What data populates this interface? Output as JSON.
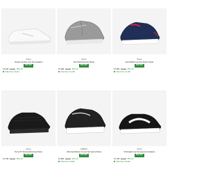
{
  "products": [
    {
      "brand": "Puma",
      "title": "Cintara Comfort Low-Top Sneakers",
      "discount": "55% OFF",
      "price": "₹1,349",
      "mrp": "₹2,999",
      "off": "55% off",
      "offer": "Offer Price: ₹1,214",
      "image": "white-low-sneaker"
    },
    {
      "brand": "Puma",
      "title": "Flex Mesh Running Shoes",
      "discount": "50% OFF",
      "price": "₹1,999",
      "mrp": "₹3,999",
      "off": "50% off",
      "offer": "Offer Price: ₹1,799",
      "image": "grey-running-shoe"
    },
    {
      "brand": "Puma",
      "title": "Axel Athletic Low-Top Sports Shoes",
      "discount": "50% OFF",
      "price": "₹1,999",
      "mrp": "₹3,999",
      "off": "50% off",
      "offer": "Offer Price: ₹1,799",
      "image": "navy-red-sports-shoe"
    },
    {
      "brand": "Puma",
      "title": "Puma ST Textured Running Shoes",
      "discount": "55% OFF",
      "price": "₹1,799",
      "mrp": "₹3,999",
      "off": "55% off",
      "offer": "",
      "image": "black-knit-shoe"
    },
    {
      "brand": "ADIDAS",
      "title": "Ultra-Sportiboost V1 Low-Top Sports Shoes",
      "discount": "40% OFF",
      "price": "₹4,800",
      "mrp": "₹7,999",
      "off": "40% off",
      "offer": "Offer Price: ₹4,320",
      "image": "black-chunky-shoe"
    },
    {
      "brand": "Puma",
      "title": "Perforated Low-Top Lace-Up Sneakers",
      "discount": "55% OFF",
      "price": "₹1,799",
      "mrp": "₹3,999",
      "off": "55% off",
      "offer": "Offer Price: ₹1,619",
      "image": "black-white-sneaker"
    }
  ],
  "colors": {
    "badge": "#2f8a3b",
    "image_bg": "#f4f4f4"
  }
}
